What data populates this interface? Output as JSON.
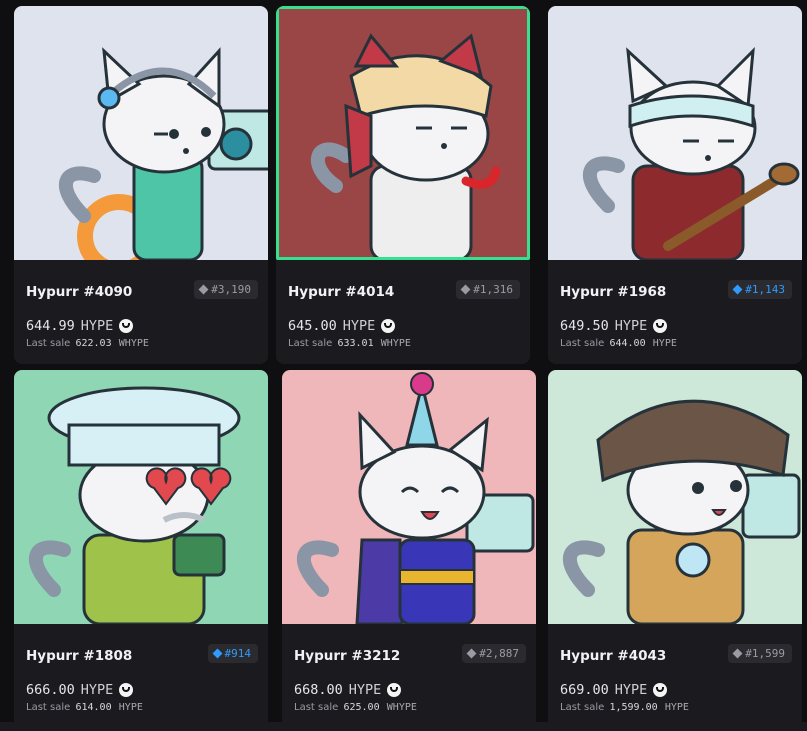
{
  "colors": {
    "selected_outline": "#35e08f",
    "rare_badge": "#2f9bff",
    "card_bg": "#1b1b1f"
  },
  "cards": [
    {
      "name": "Hypurr #4090",
      "rank": "#3,190",
      "rank_style": "common",
      "price": "644.99",
      "currency": "HYPE",
      "last_label": "Last sale",
      "last_value": "622.03",
      "last_currency": "WHYPE",
      "bg": "#dfe3ee",
      "selected": false
    },
    {
      "name": "Hypurr #4014",
      "rank": "#1,316",
      "rank_style": "common",
      "price": "645.00",
      "currency": "HYPE",
      "last_label": "Last sale",
      "last_value": "633.01",
      "last_currency": "WHYPE",
      "bg": "#9a4546",
      "selected": true
    },
    {
      "name": "Hypurr #1968",
      "rank": "#1,143",
      "rank_style": "rare",
      "price": "649.50",
      "currency": "HYPE",
      "last_label": "Last sale",
      "last_value": "644.00",
      "last_currency": "HYPE",
      "bg": "#dfe3ee",
      "selected": false
    },
    {
      "name": "Hypurr #1808",
      "rank": "#914",
      "rank_style": "rare",
      "price": "666.00",
      "currency": "HYPE",
      "last_label": "Last sale",
      "last_value": "614.00",
      "last_currency": "HYPE",
      "bg": "#8fd6b5",
      "selected": false
    },
    {
      "name": "Hypurr #3212",
      "rank": "#2,887",
      "rank_style": "common",
      "price": "668.00",
      "currency": "HYPE",
      "last_label": "Last sale",
      "last_value": "625.00",
      "last_currency": "WHYPE",
      "bg": "#efb7ba",
      "selected": false
    },
    {
      "name": "Hypurr #4043",
      "rank": "#1,599",
      "rank_style": "common",
      "price": "669.00",
      "currency": "HYPE",
      "last_label": "Last sale",
      "last_value": "1,599.00",
      "last_currency": "HYPE",
      "bg": "#cde7d9",
      "selected": false
    }
  ]
}
